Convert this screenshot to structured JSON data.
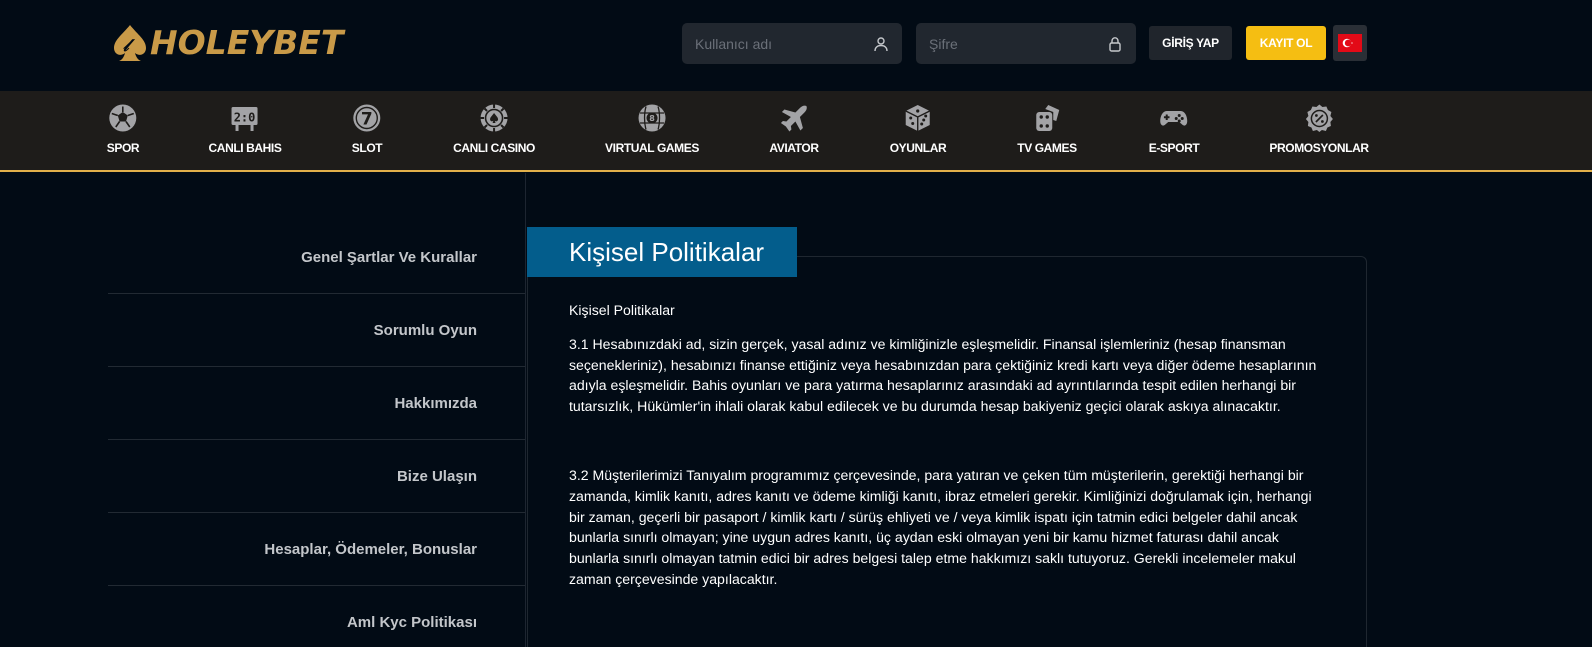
{
  "brand": {
    "name": "HOLEYBET",
    "color": "#c99a48"
  },
  "header": {
    "username_placeholder": "Kullanıcı adı",
    "password_placeholder": "Şifre",
    "login_label": "GİRİŞ YAP",
    "register_label": "KAYIT OL",
    "language_flag": "turkey-flag-icon"
  },
  "nav": {
    "items": [
      {
        "label": "SPOR",
        "icon": "soccer-ball-icon"
      },
      {
        "label": "CANLI BAHIS",
        "icon": "scoreboard-icon"
      },
      {
        "label": "SLOT",
        "icon": "slot-seven-icon"
      },
      {
        "label": "CANLI CASINO",
        "icon": "casino-chip-icon"
      },
      {
        "label": "VIRTUAL GAMES",
        "icon": "virtual-ball-icon"
      },
      {
        "label": "AVIATOR",
        "icon": "airplane-icon"
      },
      {
        "label": "OYUNLAR",
        "icon": "dice-icon"
      },
      {
        "label": "TV GAMES",
        "icon": "tv-dice-icon"
      },
      {
        "label": "E-SPORT",
        "icon": "gamepad-icon"
      },
      {
        "label": "PROMOSYONLAR",
        "icon": "promo-badge-icon"
      }
    ],
    "accent": "#e2b04a"
  },
  "sidebar": {
    "items": [
      {
        "label": "Genel Şartlar Ve Kurallar"
      },
      {
        "label": "Sorumlu Oyun"
      },
      {
        "label": "Hakkımızda"
      },
      {
        "label": "Bize Ulaşın"
      },
      {
        "label": "Hesaplar, Ödemeler, Bonuslar"
      },
      {
        "label": "Aml Kyc Politikası"
      }
    ]
  },
  "content": {
    "tab_title": "Kişisel Politikalar",
    "tab_color": "#035d8c",
    "subtitle": "Kişisel Politikalar",
    "paragraphs": [
      "3.1 Hesabınızdaki ad, sizin gerçek, yasal adınız ve kimliğinizle eşleşmelidir. Finansal işlemleriniz (hesap finansman seçenekleriniz), hesabınızı finanse ettiğiniz veya hesabınızdan para çektiğiniz kredi kartı veya diğer ödeme hesaplarının adıyla eşleşmelidir. Bahis oyunları ve para yatırma hesaplarınız arasındaki ad ayrıntılarında tespit edilen herhangi bir tutarsızlık, Hükümler'in ihlali olarak kabul edilecek ve bu durumda hesap bakiyeniz geçici olarak askıya alınacaktır.",
      "3.2 Müşterilerimizi Tanıyalım programımız çerçevesinde, para yatıran ve çeken tüm müşterilerin, gerektiği herhangi bir zamanda, kimlik kanıtı, adres kanıtı ve ödeme kimliği kanıtı, ibraz etmeleri gerekir. Kimliğinizi doğrulamak için, herhangi bir zaman, geçerli bir pasaport / kimlik kartı / sürüş ehliyeti ve / veya kimlik ispatı için tatmin edici belgeler dahil ancak bunlarla sınırlı olmayan; yine uygun adres kanıtı, üç aydan eski olmayan yeni bir kamu hizmet faturası dahil ancak bunlarla sınırlı olmayan tatmin edici bir adres belgesi talep etme hakkımızı saklı tutuyoruz. Gerekli incelemeler makul zaman çerçevesinde yapılacaktır."
    ]
  }
}
